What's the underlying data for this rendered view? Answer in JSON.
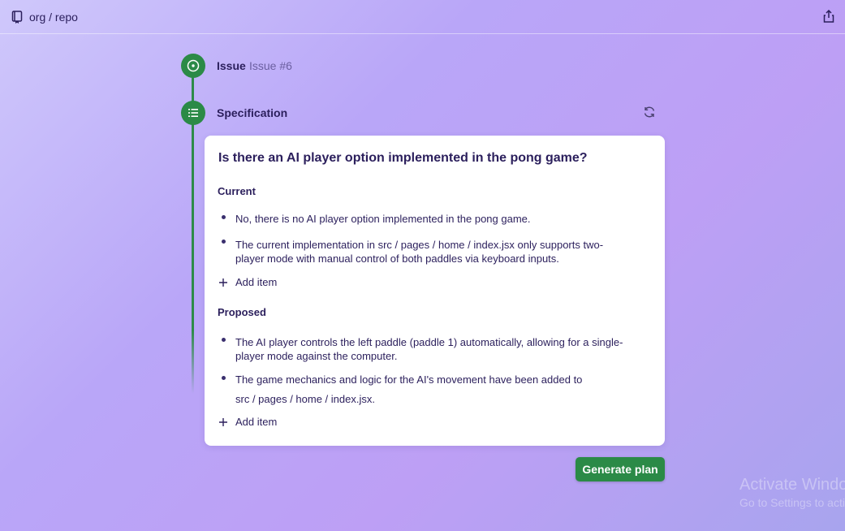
{
  "header": {
    "repo_path": "org / repo",
    "repo_icon": "repo-icon",
    "share_icon": "share-icon"
  },
  "timeline": {
    "issue": {
      "label": "Issue",
      "number": "Issue #6",
      "icon": "issue-open-icon"
    },
    "specification": {
      "label": "Specification",
      "icon": "list-icon",
      "refresh_icon": "refresh-icon"
    }
  },
  "spec_card": {
    "question": "Is there an AI player option implemented in the pong game?",
    "current": {
      "title": "Current",
      "items": [
        "No, there is no AI player option implemented in the pong game.",
        "The current implementation in src / pages / home / index.jsx only supports two-player mode with manual control of both paddles via keyboard inputs."
      ],
      "add_label": "Add item"
    },
    "proposed": {
      "title": "Proposed",
      "items": [
        "The AI player controls the left paddle (paddle 1) automatically, allowing for a single-player mode against the computer.",
        "The game mechanics and logic for the AI's movement have been added to",
        "src / pages / home / index.jsx."
      ],
      "add_label": "Add item"
    }
  },
  "actions": {
    "generate_label": "Generate plan"
  },
  "watermark": {
    "line1": "Activate Windows",
    "line2": "Go to Settings to activate Windows."
  },
  "colors": {
    "accent_green": "#2b8a47",
    "text": "#2b1f5c",
    "card_bg": "#ffffff"
  }
}
